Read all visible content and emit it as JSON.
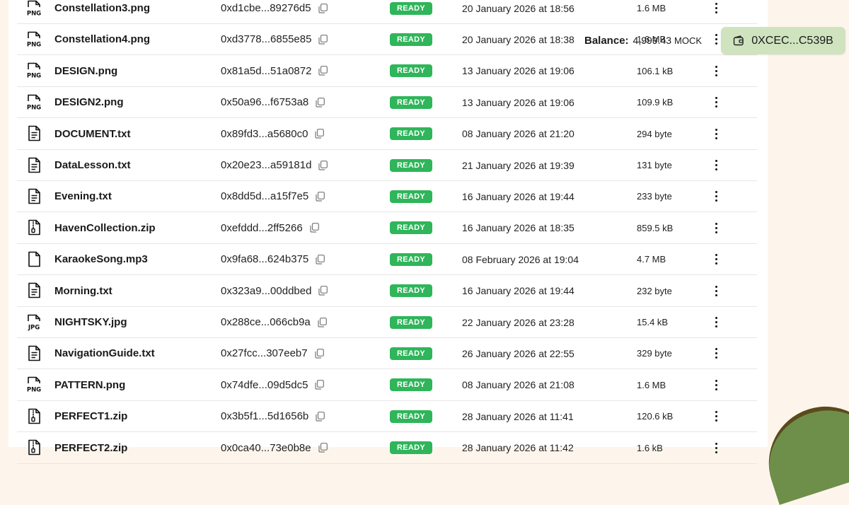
{
  "wallet": {
    "balance_label": "Balance:",
    "balance_value": "4,999.43",
    "balance_unit": "MOCK",
    "address": "0XCEC...C539B"
  },
  "files": [
    {
      "icon": "png-file-icon",
      "name": "Constellation3.png",
      "hash": "0xd1cbe...89276d5",
      "status": "READY",
      "date": "20 January 2026 at 18:56",
      "size": "1.6 MB"
    },
    {
      "icon": "png-file-icon",
      "name": "Constellation4.png",
      "hash": "0xd3778...6855e85",
      "status": "READY",
      "date": "20 January 2026 at 18:38",
      "size": "1.6 MB"
    },
    {
      "icon": "png-file-icon",
      "name": "DESIGN.png",
      "hash": "0x81a5d...51a0872",
      "status": "READY",
      "date": "13 January 2026 at 19:06",
      "size": "106.1 kB"
    },
    {
      "icon": "png-file-icon",
      "name": "DESIGN2.png",
      "hash": "0x50a96...f6753a8",
      "status": "READY",
      "date": "13 January 2026 at 19:06",
      "size": "109.9 kB"
    },
    {
      "icon": "text-file-icon",
      "name": "DOCUMENT.txt",
      "hash": "0x89fd3...a5680c0",
      "status": "READY",
      "date": "08 January 2026 at 21:20",
      "size": "294 byte"
    },
    {
      "icon": "text-file-icon",
      "name": "DataLesson.txt",
      "hash": "0x20e23...a59181d",
      "status": "READY",
      "date": "21 January 2026 at 19:39",
      "size": "131 byte"
    },
    {
      "icon": "text-file-icon",
      "name": "Evening.txt",
      "hash": "0x8dd5d...a15f7e5",
      "status": "READY",
      "date": "16 January 2026 at 19:44",
      "size": "233 byte"
    },
    {
      "icon": "zip-file-icon",
      "name": "HavenCollection.zip",
      "hash": "0xefddd...2ff5266",
      "status": "READY",
      "date": "16 January 2026 at 18:35",
      "size": "859.5 kB"
    },
    {
      "icon": "file-icon",
      "name": "KaraokeSong.mp3",
      "hash": "0x9fa68...624b375",
      "status": "READY",
      "date": "08 February 2026 at 19:04",
      "size": "4.7 MB"
    },
    {
      "icon": "text-file-icon",
      "name": "Morning.txt",
      "hash": "0x323a9...00ddbed",
      "status": "READY",
      "date": "16 January 2026 at 19:44",
      "size": "232 byte"
    },
    {
      "icon": "jpg-file-icon",
      "name": "NIGHTSKY.jpg",
      "hash": "0x288ce...066cb9a",
      "status": "READY",
      "date": "22 January 2026 at 23:28",
      "size": "15.4 kB"
    },
    {
      "icon": "text-file-icon",
      "name": "NavigationGuide.txt",
      "hash": "0x27fcc...307eeb7",
      "status": "READY",
      "date": "26 January 2026 at 22:55",
      "size": "329 byte"
    },
    {
      "icon": "png-file-icon",
      "name": "PATTERN.png",
      "hash": "0x74dfe...09d5dc5",
      "status": "READY",
      "date": "08 January 2026 at 21:08",
      "size": "1.6 MB"
    },
    {
      "icon": "zip-file-icon",
      "name": "PERFECT1.zip",
      "hash": "0x3b5f1...5d1656b",
      "status": "READY",
      "date": "28 January 2026 at 11:41",
      "size": "120.6 kB"
    },
    {
      "icon": "zip-file-icon",
      "name": "PERFECT2.zip",
      "hash": "0x0ca40...73e0b8e",
      "status": "READY",
      "date": "28 January 2026 at 11:42",
      "size": "1.6 kB"
    }
  ]
}
